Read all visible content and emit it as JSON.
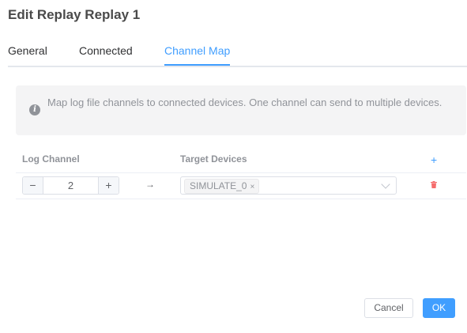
{
  "dialog": {
    "title": "Edit Replay Replay 1"
  },
  "tabs": [
    {
      "label": "General",
      "active": false
    },
    {
      "label": "Connected",
      "active": false
    },
    {
      "label": "Channel Map",
      "active": true
    }
  ],
  "info": {
    "icon": "info-circle-icon",
    "text": "Map log file channels to connected devices. One channel can send to multiple devices."
  },
  "table": {
    "headers": {
      "log_channel": "Log Channel",
      "target_devices": "Target Devices",
      "add": "+"
    },
    "rows": [
      {
        "stepper": {
          "minus": "−",
          "value": "2",
          "plus": "+"
        },
        "arrow": "→",
        "targets": [
          {
            "label": "SIMULATE_0",
            "close": "×"
          }
        ]
      }
    ]
  },
  "footer": {
    "cancel_label": "Cancel",
    "ok_label": "OK"
  },
  "colors": {
    "accent": "#409eff",
    "danger": "#f56c6c",
    "info_bg": "#f4f4f5"
  }
}
